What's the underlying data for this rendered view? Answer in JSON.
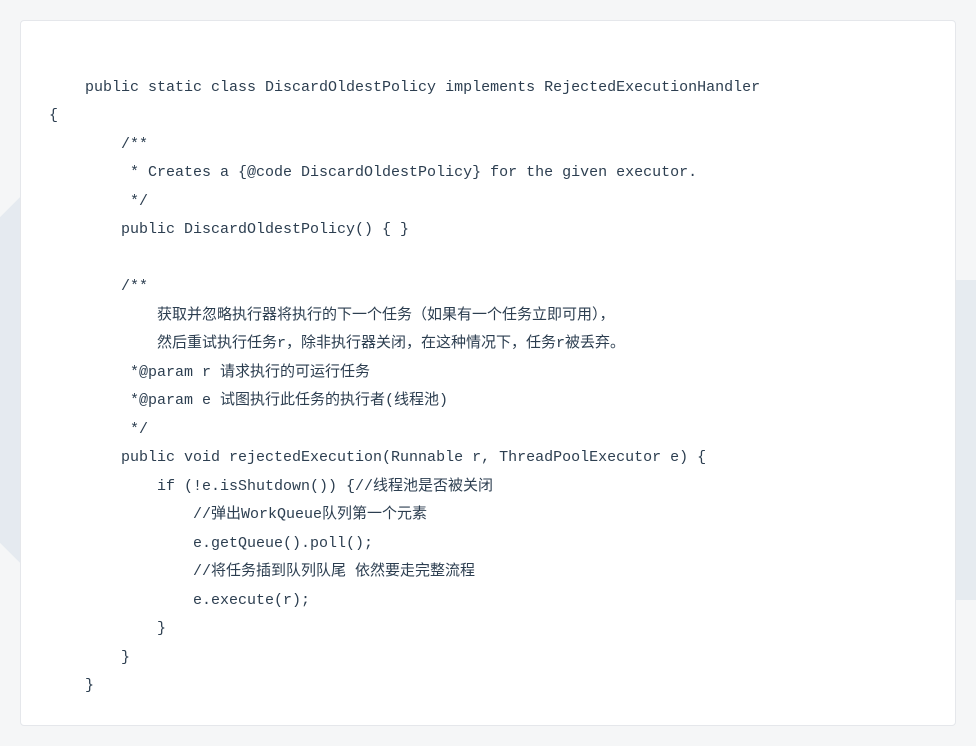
{
  "code": {
    "lines": [
      "",
      "    public static class DiscardOldestPolicy implements RejectedExecutionHandler",
      "{",
      "        /**",
      "         * Creates a {@code DiscardOldestPolicy} for the given executor.",
      "         */",
      "        public DiscardOldestPolicy() { }",
      "",
      "        /**",
      "            获取并忽略执行器将执行的下一个任务（如果有一个任务立即可用），",
      "            然后重试执行任务r，除非执行器关闭，在这种情况下，任务r被丢弃。",
      "         *@param r 请求执行的可运行任务",
      "         *@param e 试图执行此任务的执行者(线程池)",
      "         */",
      "        public void rejectedExecution(Runnable r, ThreadPoolExecutor e) {",
      "            if (!e.isShutdown()) {//线程池是否被关闭",
      "                //弹出WorkQueue队列第一个元素",
      "                e.getQueue().poll();",
      "                //将任务插到队列队尾 依然要走完整流程",
      "                e.execute(r);",
      "            }",
      "        }",
      "    }"
    ]
  }
}
